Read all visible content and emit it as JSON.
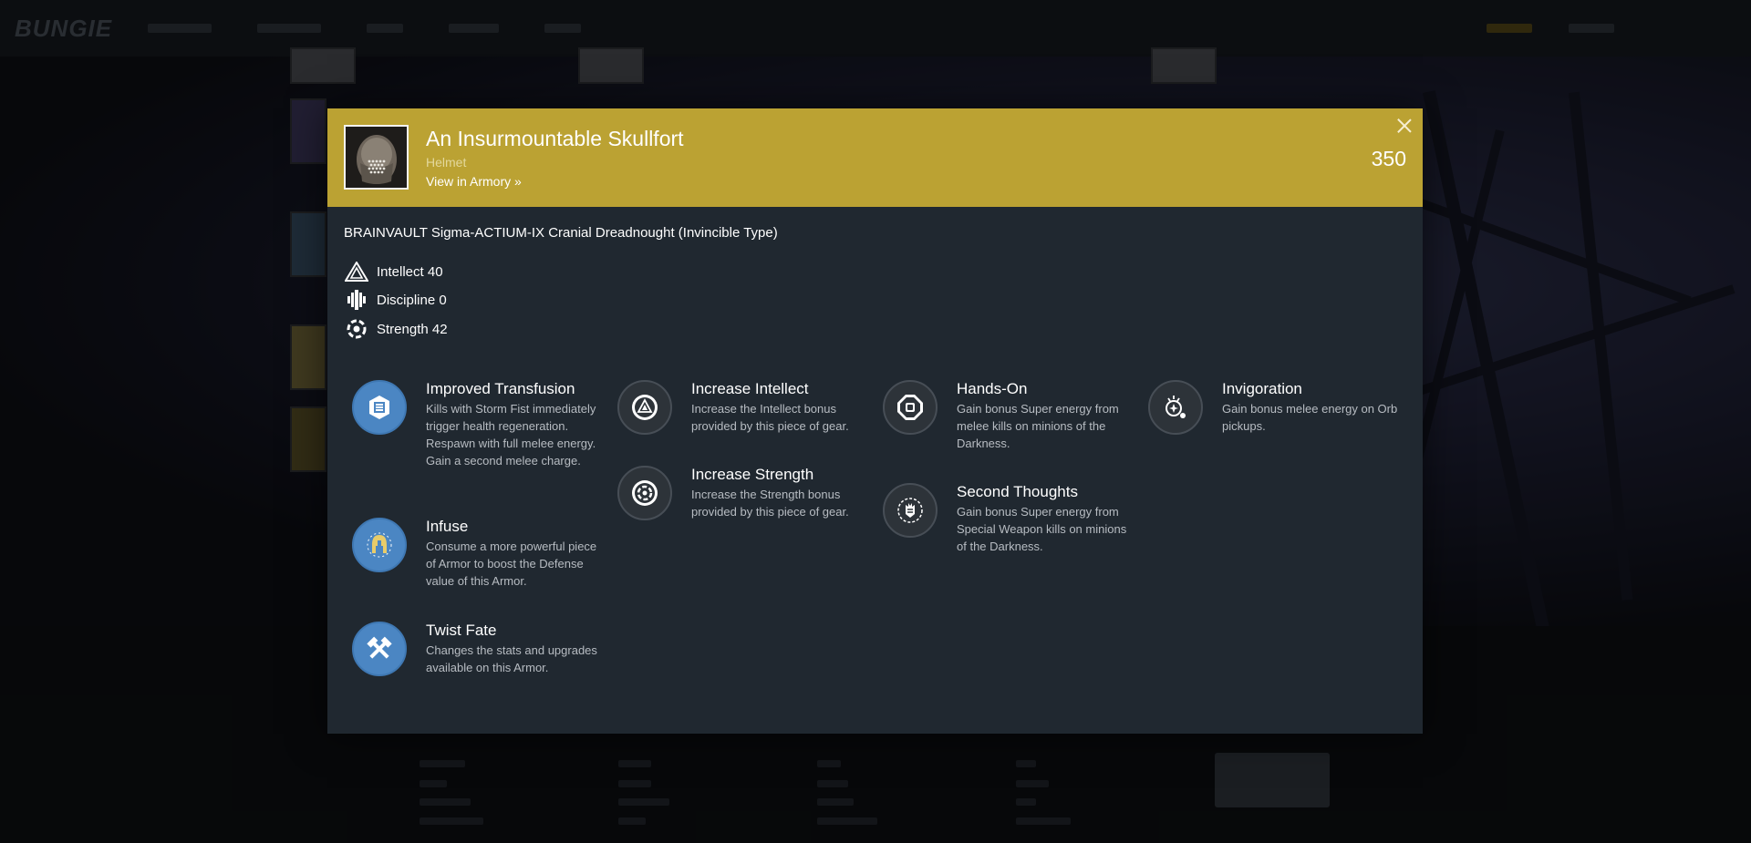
{
  "item": {
    "name": "An Insurmountable Skullfort",
    "type": "Helmet",
    "armory_link": "View in Armory »",
    "defense": "350",
    "description": "BRAINVAULT Sigma-ACTIUM-IX Cranial Dreadnought (Invincible Type)"
  },
  "stats": [
    {
      "label": "Intellect 40",
      "icon": "intellect-icon"
    },
    {
      "label": "Discipline 0",
      "icon": "discipline-icon"
    },
    {
      "label": "Strength 42",
      "icon": "strength-icon"
    }
  ],
  "perks": {
    "col1": [
      {
        "name": "Improved Transfusion",
        "desc": "Kills with Storm Fist immediately trigger health regeneration. Respawn with full melee energy. Gain a second melee charge.",
        "icon": "transfusion-icon"
      },
      {
        "name": "Infuse",
        "desc": "Consume a more powerful piece of Armor to boost the Defense value of this Armor.",
        "icon": "infuse-helmet-icon"
      },
      {
        "name": "Twist Fate",
        "desc": "Changes the stats and upgrades available on this Armor.",
        "icon": "crossed-hammers-icon"
      }
    ],
    "col2": [
      {
        "name": "Increase Intellect",
        "desc": "Increase the Intellect bonus provided by this piece of gear.",
        "icon": "intellect-icon"
      },
      {
        "name": "Increase Strength",
        "desc": "Increase the Strength bonus provided by this piece of gear.",
        "icon": "strength-icon"
      }
    ],
    "col3": [
      {
        "name": "Hands-On",
        "desc": "Gain bonus Super energy from melee kills on minions of the Darkness.",
        "icon": "hands-on-icon"
      },
      {
        "name": "Second Thoughts",
        "desc": "Gain bonus Super energy from Special Weapon kills on minions of the Darkness.",
        "icon": "second-thoughts-icon"
      }
    ],
    "col4": [
      {
        "name": "Invigoration",
        "desc": "Gain bonus melee energy on Orb pickups.",
        "icon": "invigoration-icon"
      }
    ]
  },
  "colors": {
    "header": "#bba233",
    "modal_bg": "#202830",
    "perk_active": "#4b86c3",
    "perk_inactive": "#2d3339"
  }
}
